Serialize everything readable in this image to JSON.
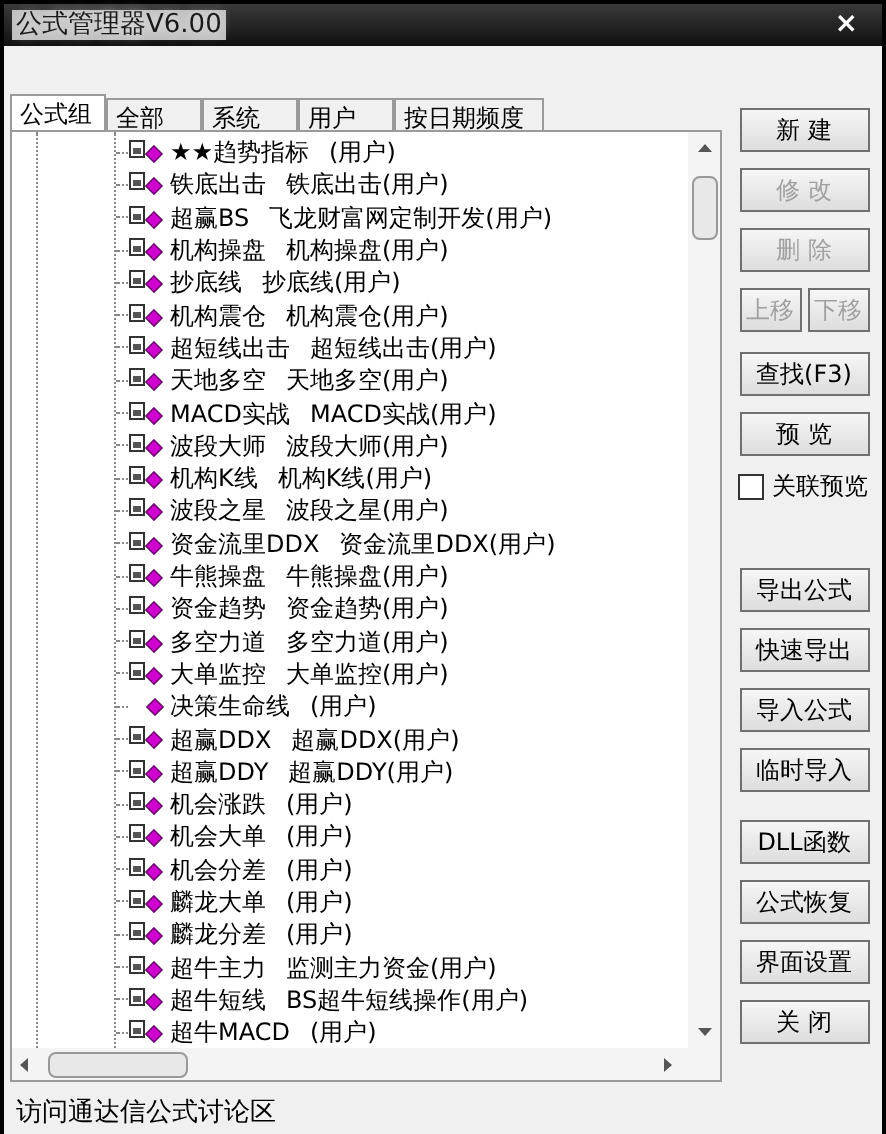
{
  "window": {
    "title": "公式管理器V6.00",
    "close": "×"
  },
  "tabs": [
    {
      "label": "公式组",
      "selected": true
    },
    {
      "label": "全部",
      "selected": false
    },
    {
      "label": "系统",
      "selected": false
    },
    {
      "label": "用户",
      "selected": false
    },
    {
      "label": "按日期频度",
      "selected": false
    }
  ],
  "tree": [
    {
      "kind": "locked",
      "name": "★★趋势指标",
      "detail": "(用户)"
    },
    {
      "kind": "locked",
      "name": "铁底出击",
      "detail": "铁底出击(用户)"
    },
    {
      "kind": "locked",
      "name": "超赢BS",
      "detail": "飞龙财富网定制开发(用户)"
    },
    {
      "kind": "locked",
      "name": "机构操盘",
      "detail": "机构操盘(用户)"
    },
    {
      "kind": "locked",
      "name": "抄底线",
      "detail": "抄底线(用户)"
    },
    {
      "kind": "locked",
      "name": "机构震仓",
      "detail": "机构震仓(用户)"
    },
    {
      "kind": "locked",
      "name": "超短线出击",
      "detail": "超短线出击(用户)"
    },
    {
      "kind": "locked",
      "name": "天地多空",
      "detail": "天地多空(用户)"
    },
    {
      "kind": "locked",
      "name": "MACD实战",
      "detail": "MACD实战(用户)"
    },
    {
      "kind": "locked",
      "name": "波段大师",
      "detail": "波段大师(用户)"
    },
    {
      "kind": "locked",
      "name": "机构K线",
      "detail": "机构K线(用户)"
    },
    {
      "kind": "locked",
      "name": "波段之星",
      "detail": "波段之星(用户)"
    },
    {
      "kind": "locked",
      "name": "资金流里DDX",
      "detail": "资金流里DDX(用户)"
    },
    {
      "kind": "locked",
      "name": "牛熊操盘",
      "detail": "牛熊操盘(用户)"
    },
    {
      "kind": "locked",
      "name": "资金趋势",
      "detail": "资金趋势(用户)"
    },
    {
      "kind": "locked",
      "name": "多空力道",
      "detail": "多空力道(用户)"
    },
    {
      "kind": "locked",
      "name": "大单监控",
      "detail": "大单监控(用户)"
    },
    {
      "kind": "plain",
      "name": "决策生命线",
      "detail": "(用户)"
    },
    {
      "kind": "locked",
      "name": "超赢DDX",
      "detail": "超赢DDX(用户)"
    },
    {
      "kind": "locked",
      "name": "超赢DDY",
      "detail": "超赢DDY(用户)"
    },
    {
      "kind": "locked",
      "name": "机会涨跌",
      "detail": "(用户)"
    },
    {
      "kind": "locked",
      "name": "机会大单",
      "detail": "(用户)"
    },
    {
      "kind": "locked",
      "name": "机会分差",
      "detail": "(用户)"
    },
    {
      "kind": "locked",
      "name": "麟龙大单",
      "detail": "(用户)"
    },
    {
      "kind": "locked",
      "name": "麟龙分差",
      "detail": "(用户)"
    },
    {
      "kind": "locked",
      "name": "超牛主力",
      "detail": "监测主力资金(用户)"
    },
    {
      "kind": "locked",
      "name": "超牛短线",
      "detail": "BS超牛短线操作(用户)"
    },
    {
      "kind": "locked",
      "name": "超牛MACD",
      "detail": "(用户)"
    }
  ],
  "buttons_top": [
    {
      "label": "新 建",
      "disabled": false
    },
    {
      "label": "修 改",
      "disabled": true
    },
    {
      "label": "删 除",
      "disabled": true
    }
  ],
  "move_buttons": [
    {
      "label": "上移",
      "disabled": true
    },
    {
      "label": "下移",
      "disabled": true
    }
  ],
  "buttons_mid": [
    {
      "label": "查找(F3)",
      "disabled": false
    },
    {
      "label": "预 览",
      "disabled": false
    }
  ],
  "preview_checkbox": {
    "label": "关联预览",
    "checked": false
  },
  "buttons_io": [
    {
      "label": "导出公式",
      "disabled": false
    },
    {
      "label": "快速导出",
      "disabled": false
    },
    {
      "label": "导入公式",
      "disabled": false
    },
    {
      "label": "临时导入",
      "disabled": false
    }
  ],
  "buttons_bottom": [
    {
      "label": "DLL函数",
      "disabled": false
    },
    {
      "label": "公式恢复",
      "disabled": false
    },
    {
      "label": "界面设置",
      "disabled": false
    },
    {
      "label": "关 闭",
      "disabled": false
    }
  ],
  "status_bar": {
    "text": "访问通达信公式讨论区"
  }
}
